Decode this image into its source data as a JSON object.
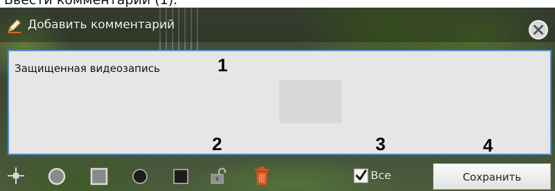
{
  "top_caption": "Ввести комментарий (1).",
  "dialog": {
    "title": "Добавить комментарий",
    "icons": {
      "title_icon": "pencil-icon",
      "close": "close-icon"
    }
  },
  "comment": {
    "value": "Защищенная видеозапись"
  },
  "markers": [
    "1",
    "2",
    "3",
    "4"
  ],
  "toolbar": {
    "tools": [
      {
        "name": "crosshair-icon"
      },
      {
        "name": "circle-outline-icon"
      },
      {
        "name": "square-outline-icon"
      },
      {
        "name": "circle-filled-icon"
      },
      {
        "name": "square-filled-icon"
      },
      {
        "name": "unlock-icon"
      },
      {
        "name": "trash-icon"
      }
    ],
    "all_label": "Все",
    "all_checked": true,
    "save_label": "Сохранить"
  },
  "colors": {
    "comment_border": "#4f90c4",
    "comment_background": "#e6e6e6",
    "trash": "#d9531e"
  }
}
